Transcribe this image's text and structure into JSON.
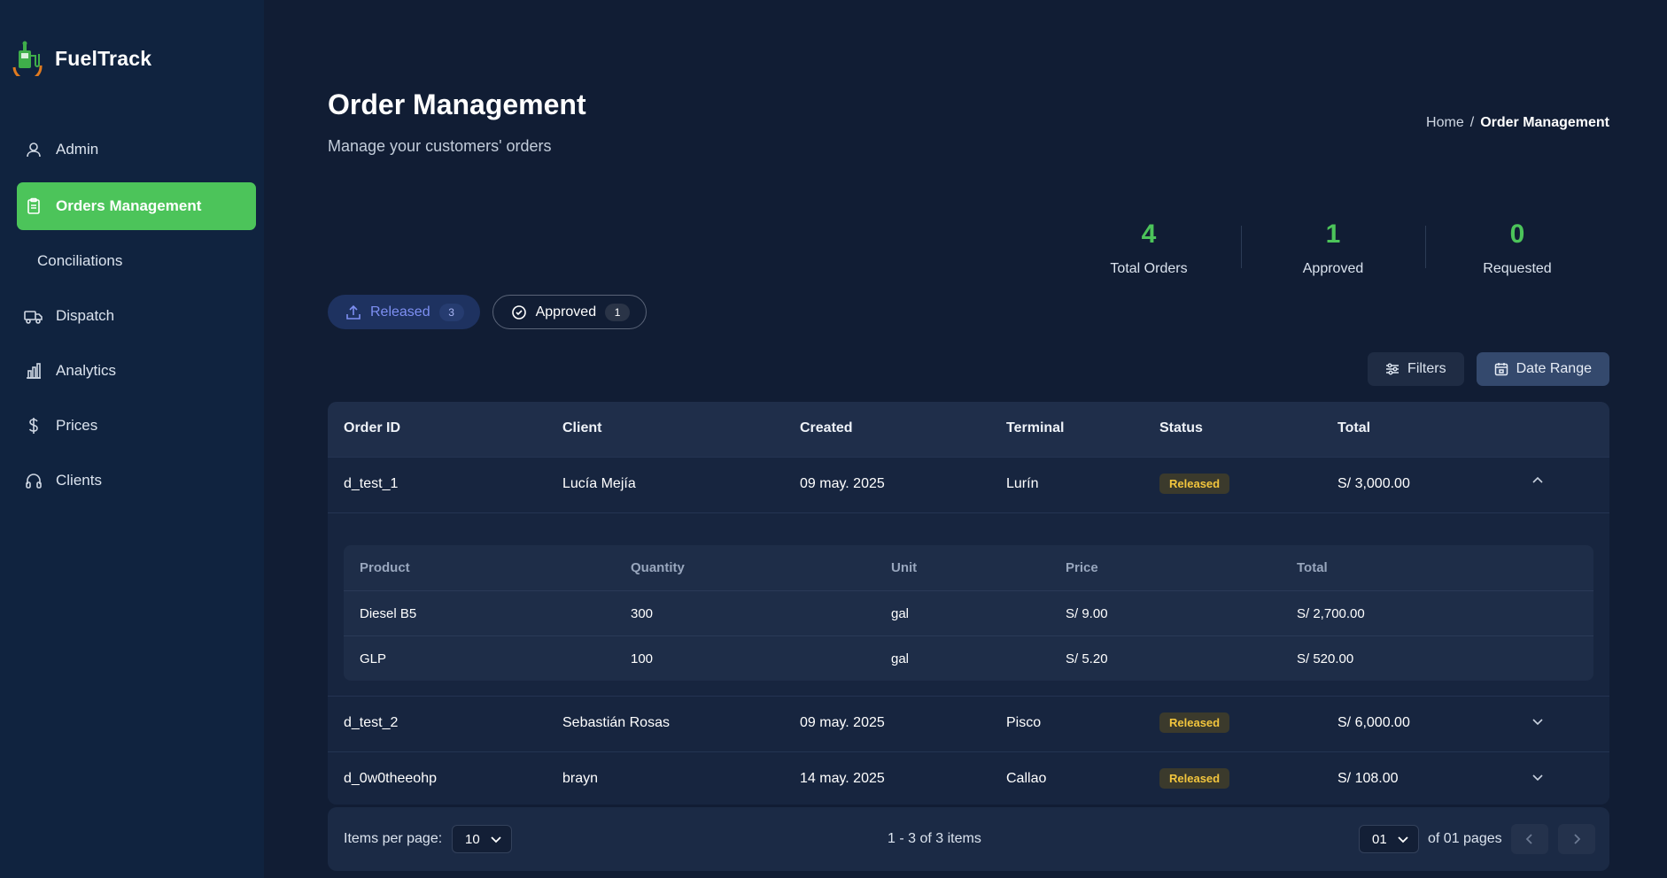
{
  "app": {
    "name": "FuelTrack"
  },
  "sidebar": {
    "items": [
      {
        "label": "Admin",
        "icon": "user-icon"
      },
      {
        "label": "Orders Management",
        "icon": "clipboard-icon",
        "active": true
      },
      {
        "label": "Conciliations",
        "icon": ""
      },
      {
        "label": "Dispatch",
        "icon": "truck-icon"
      },
      {
        "label": "Analytics",
        "icon": "bar-chart-icon"
      },
      {
        "label": "Prices",
        "icon": "dollar-icon"
      },
      {
        "label": "Clients",
        "icon": "headphones-icon"
      }
    ]
  },
  "header": {
    "title": "Order Management",
    "subtitle": "Manage your customers' orders",
    "breadcrumb": {
      "home": "Home",
      "separator": "/",
      "current": "Order Management"
    }
  },
  "stats": [
    {
      "value": "4",
      "label": "Total Orders"
    },
    {
      "value": "1",
      "label": "Approved"
    },
    {
      "value": "0",
      "label": "Requested"
    }
  ],
  "chips": {
    "released": {
      "label": "Released",
      "count": "3"
    },
    "approved": {
      "label": "Approved",
      "count": "1"
    }
  },
  "actions": {
    "filters": "Filters",
    "date_range": "Date Range"
  },
  "table": {
    "columns": [
      "Order ID",
      "Client",
      "Created",
      "Terminal",
      "Status",
      "Total"
    ],
    "rows": [
      {
        "id": "d_test_1",
        "client": "Lucía Mejía",
        "created": "09 may. 2025",
        "terminal": "Lurín",
        "status": "Released",
        "total": "S/ 3,000.00",
        "expanded": true
      },
      {
        "id": "d_test_2",
        "client": "Sebastián Rosas",
        "created": "09 may. 2025",
        "terminal": "Pisco",
        "status": "Released",
        "total": "S/ 6,000.00"
      },
      {
        "id": "d_0w0theeohp",
        "client": "brayn",
        "created": "14 may. 2025",
        "terminal": "Callao",
        "status": "Released",
        "total": "S/ 108.00"
      }
    ],
    "detail": {
      "columns": [
        "Product",
        "Quantity",
        "Unit",
        "Price",
        "Total"
      ],
      "rows": [
        {
          "product": "Diesel B5",
          "quantity": "300",
          "unit": "gal",
          "price": "S/ 9.00",
          "total": "S/ 2,700.00"
        },
        {
          "product": "GLP",
          "quantity": "100",
          "unit": "gal",
          "price": "S/ 5.20",
          "total": "S/ 520.00"
        }
      ]
    }
  },
  "pagination": {
    "items_per_page_label": "Items per page:",
    "items_per_page": "10",
    "summary": "1 - 3 of 3 items",
    "page": "01",
    "of_pages": "of 01 pages"
  },
  "colors": {
    "accent": "#4cc45a",
    "badge_text": "#f2c53d",
    "chip_released": "#7d8ff2"
  }
}
